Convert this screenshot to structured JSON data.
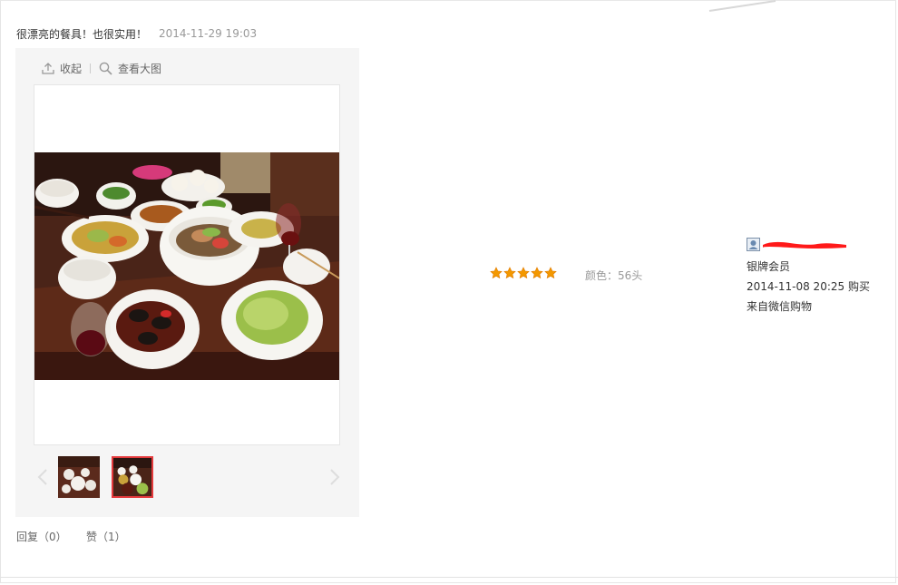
{
  "review": {
    "comment": "很漂亮的餐具！也很实用！",
    "date": "2014-11-29 19:03"
  },
  "gallery": {
    "collapse_label": "收起",
    "view_large_label": "查看大图",
    "photo_subject": "dinner table with dishes"
  },
  "rating": {
    "stars": 5,
    "max": 5,
    "star_color": "#f39800"
  },
  "product": {
    "color_spec": "颜色：56头"
  },
  "user": {
    "level": "银牌会员",
    "purchase": "2014-11-08 20:25 购买",
    "source": "来自微信购物"
  },
  "footer": {
    "reply": "回复（0）",
    "like": "赞（1）"
  },
  "colors": {
    "active_thumb_border": "#e4393c"
  }
}
